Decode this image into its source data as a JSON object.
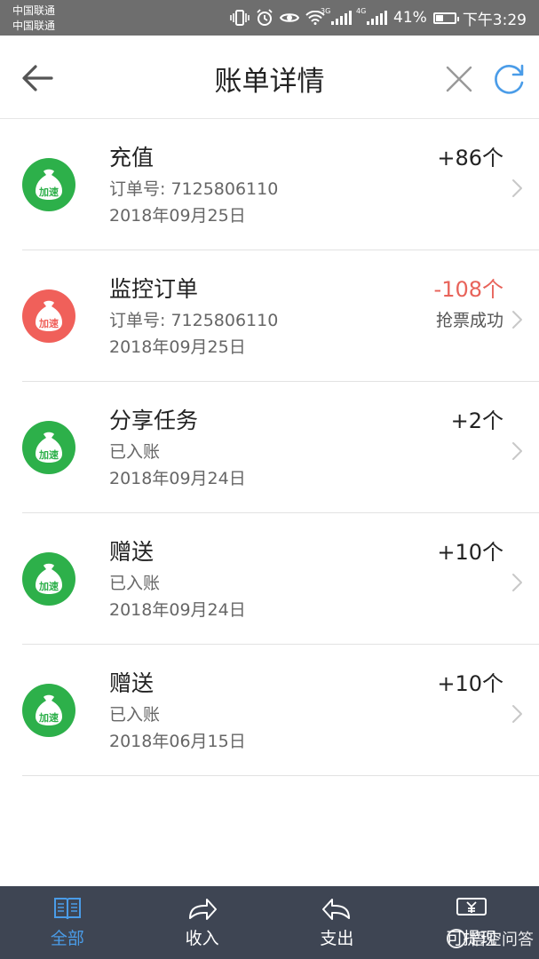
{
  "status_bar": {
    "carrier_1": "中国联通",
    "carrier_2": "中国联通",
    "network_1": "3G",
    "network_2": "4G",
    "battery": "41%",
    "battery_level": 0.41,
    "time": "下午3:29"
  },
  "navbar": {
    "title": "账单详情",
    "back_icon": "arrow-left-icon",
    "close_icon": "close-icon",
    "refresh_icon": "refresh-icon"
  },
  "badge_text": "加速",
  "records": [
    {
      "title": "充值",
      "sub": "订单号: 7125806110",
      "date": "2018年09月25日",
      "amount": "+86个",
      "status": "",
      "color": "green"
    },
    {
      "title": "监控订单",
      "sub": "订单号: 7125806110",
      "date": "2018年09月25日",
      "amount": "-108个",
      "status": "抢票成功",
      "color": "red"
    },
    {
      "title": "分享任务",
      "sub": "已入账",
      "date": "2018年09月24日",
      "amount": "+2个",
      "status": "",
      "color": "green"
    },
    {
      "title": "赠送",
      "sub": "已入账",
      "date": "2018年09月24日",
      "amount": "+10个",
      "status": "",
      "color": "green"
    },
    {
      "title": "赠送",
      "sub": "已入账",
      "date": "2018年06月15日",
      "amount": "+10个",
      "status": "",
      "color": "green"
    }
  ],
  "tabs": [
    {
      "label": "全部",
      "icon": "book-icon",
      "active": true
    },
    {
      "label": "收入",
      "icon": "redo-arrow-icon",
      "active": false
    },
    {
      "label": "支出",
      "icon": "undo-arrow-icon",
      "active": false
    },
    {
      "label": "可提现",
      "icon": "yen-box-icon",
      "active": false
    }
  ],
  "watermark": "悟空问答",
  "colors": {
    "green": "#2db04a",
    "red": "#f0605a",
    "negative_amount": "#e8635a",
    "active_tab": "#4a9ce8",
    "tabbar_bg": "#3e4553",
    "refresh_icon": "#4a9ce8"
  }
}
